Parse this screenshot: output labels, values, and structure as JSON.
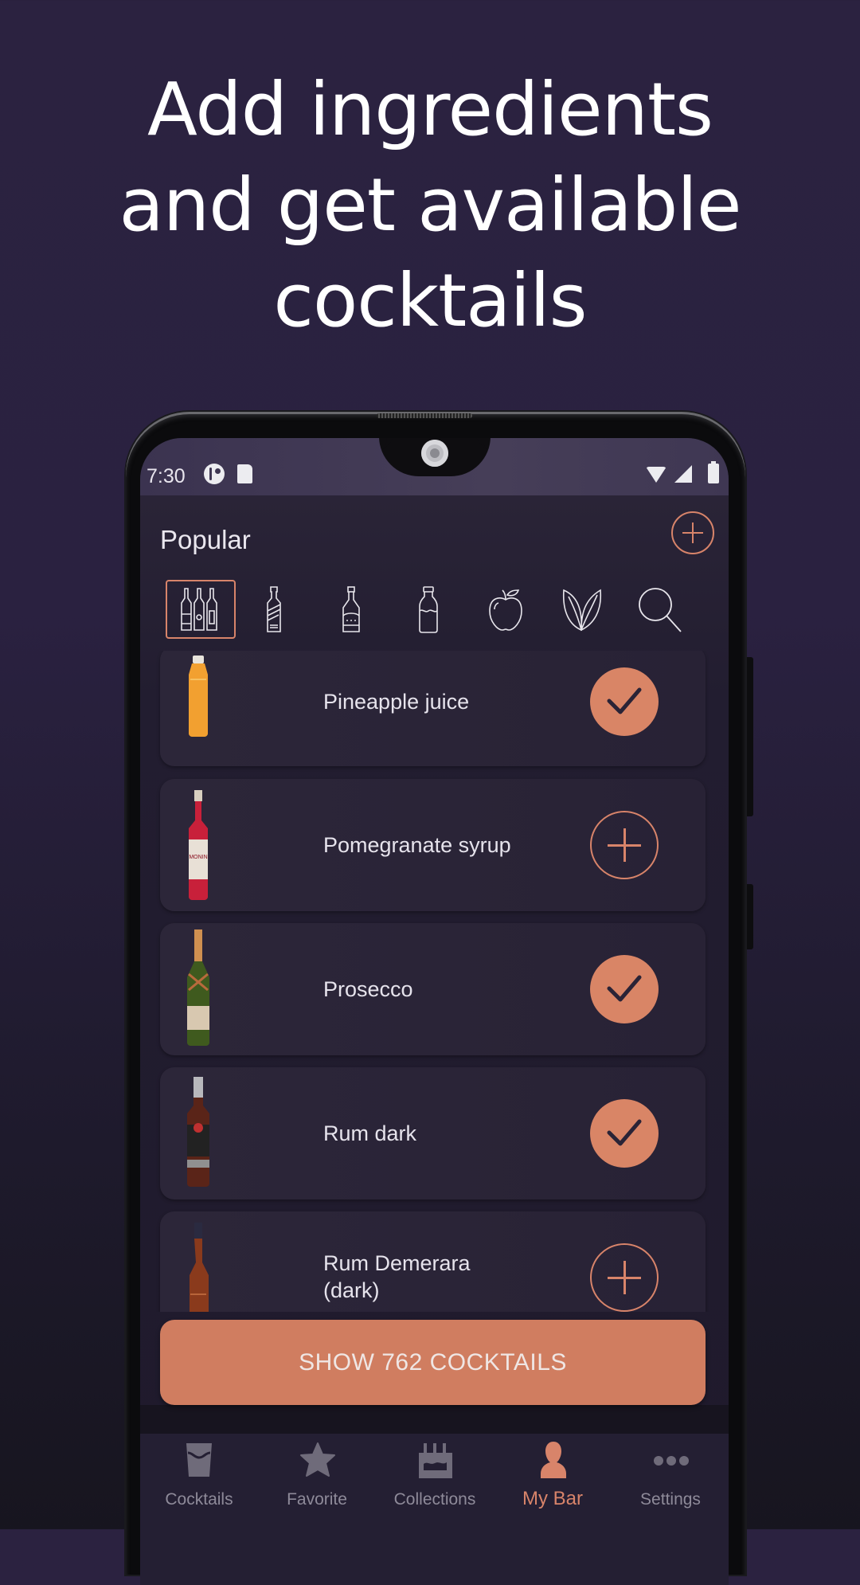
{
  "headline": {
    "lines": [
      "Add ingredients",
      "and get available",
      "cocktails"
    ]
  },
  "status_bar": {
    "time": "7:30",
    "left_icons": [
      "cast-app-icon",
      "sd-card-icon"
    ],
    "right_icons": [
      "wifi-icon",
      "signal-icon",
      "battery-icon"
    ]
  },
  "header": {
    "title": "Popular",
    "add_button": "add-circle-icon"
  },
  "categories": [
    {
      "name": "all-bottles",
      "icon": "bottles-icon",
      "selected": true
    },
    {
      "name": "spirits",
      "icon": "whiskey-bottle-icon",
      "selected": false
    },
    {
      "name": "liqueurs",
      "icon": "liqueur-bottle-icon",
      "selected": false
    },
    {
      "name": "mixers",
      "icon": "milk-bottle-icon",
      "selected": false
    },
    {
      "name": "fruits",
      "icon": "apple-icon",
      "selected": false
    },
    {
      "name": "herbs",
      "icon": "leaves-icon",
      "selected": false
    },
    {
      "name": "search",
      "icon": "search-icon",
      "selected": false
    }
  ],
  "ingredients": [
    {
      "name": "Pineapple juice",
      "in_bar": true,
      "bottle": "juice-bottle"
    },
    {
      "name": "Pomegranate syrup",
      "in_bar": false,
      "bottle": "syrup-bottle"
    },
    {
      "name": "Prosecco",
      "in_bar": true,
      "bottle": "champagne-bottle"
    },
    {
      "name": "Rum dark",
      "in_bar": true,
      "bottle": "rum-bottle"
    },
    {
      "name": "Rum Demerara\n(dark)",
      "line1": "Rum Demerara",
      "line2": "(dark)",
      "in_bar": false,
      "bottle": "demerara-bottle"
    }
  ],
  "show_button": {
    "label": "SHOW 762 COCKTAILS",
    "count": 762
  },
  "nav": {
    "items": [
      {
        "label": "Cocktails",
        "icon": "glass-icon",
        "active": false
      },
      {
        "label": "Favorite",
        "icon": "star-icon",
        "active": false
      },
      {
        "label": "Collections",
        "icon": "collections-icon",
        "active": false
      },
      {
        "label": "My Bar",
        "icon": "person-icon",
        "active": true
      },
      {
        "label": "Settings",
        "icon": "more-dots-icon",
        "active": false
      }
    ]
  },
  "colors": {
    "accent": "#d8846a",
    "button": "#d07d60",
    "background": "#2a2140",
    "card": "#2a2437",
    "inactive_nav": "#8e8a99"
  }
}
